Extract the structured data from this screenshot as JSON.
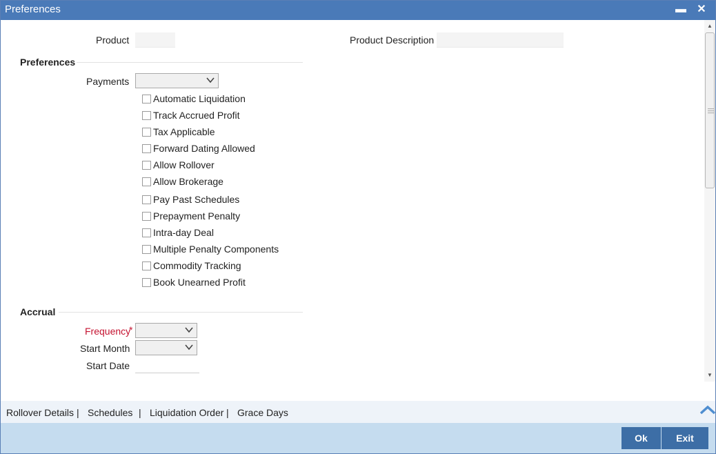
{
  "window": {
    "title": "Preferences",
    "minimize": "▬",
    "close": "✕"
  },
  "header": {
    "product_label": "Product",
    "product_value": "",
    "description_label": "Product Description",
    "description_value": ""
  },
  "preferences": {
    "section_title": "Preferences",
    "payments_label": "Payments",
    "payments_value": "",
    "options": [
      {
        "label": "Automatic Liquidation",
        "checked": false
      },
      {
        "label": "Track Accrued Profit",
        "checked": false
      },
      {
        "label": "Tax Applicable",
        "checked": false
      },
      {
        "label": "Forward Dating Allowed",
        "checked": false
      },
      {
        "label": "Allow Rollover",
        "checked": false
      },
      {
        "label": "Allow Brokerage",
        "checked": false
      },
      {
        "label": "Pay Past Schedules",
        "checked": false
      },
      {
        "label": "Prepayment Penalty",
        "checked": false
      },
      {
        "label": "Intra-day Deal",
        "checked": false
      },
      {
        "label": "Multiple Penalty Components",
        "checked": false
      },
      {
        "label": "Commodity Tracking",
        "checked": false
      },
      {
        "label": "Book Unearned Profit",
        "checked": false
      }
    ]
  },
  "accrual": {
    "section_title": "Accrual",
    "frequency_label": "Frequency",
    "required_mark": "*",
    "frequency_value": "",
    "start_month_label": "Start Month",
    "start_month_value": "",
    "start_date_label": "Start Date",
    "start_date_value": ""
  },
  "tabs": {
    "items": [
      "Rollover Details",
      "Schedules",
      "Liquidation Order",
      "Grace Days"
    ],
    "separator": "|"
  },
  "footer": {
    "ok_label": "Ok",
    "exit_label": "Exit"
  },
  "colors": {
    "titlebar": "#4a7ab8",
    "button": "#3d6ea6",
    "footer": "#c5dcef",
    "required": "#c4122f"
  }
}
